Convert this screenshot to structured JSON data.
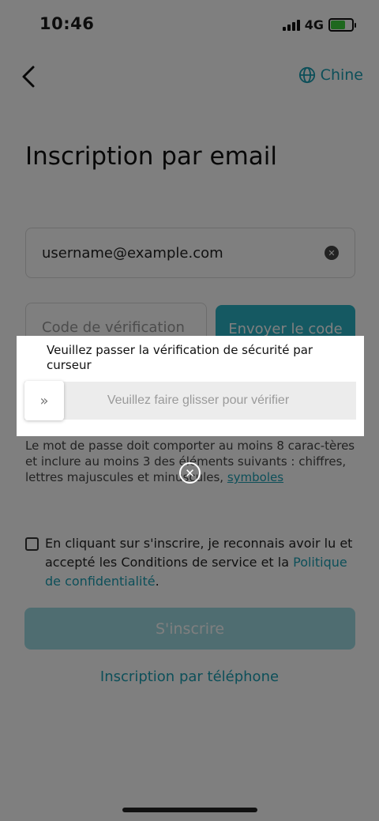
{
  "status": {
    "time": "10:46",
    "network": "4G"
  },
  "header": {
    "language": "Chine",
    "icons": {
      "back": "chevron-left-icon",
      "language": "globe-icon"
    }
  },
  "form": {
    "title": "Inscription par email",
    "email_value": "username@example.com",
    "code_placeholder": "Code de vérification",
    "send_code_label": "Envoyer le code",
    "password_hint_prefix": "Le mot de passe doit comporter au moins 8 carac-tères et inclure au moins 3 des éléments suivants : chiffres, lettres majuscules et minuscules, ",
    "password_hint_link": "symboles",
    "terms_prefix": "En cliquant sur s'inscrire, je reconnais avoir lu et accepté les Conditions de service et la ",
    "terms_link": "Politique de confidentialité",
    "terms_suffix": ".",
    "signup_label": "S'inscrire",
    "phone_signup_label": "Inscription par téléphone"
  },
  "captcha": {
    "title": "Veuillez passer la vérification de sécurité par curseur",
    "slider_text": "Veuillez faire glisser pour vérifier",
    "handle_glyph": "»",
    "close_glyph": "✕"
  },
  "colors": {
    "accent": "#1a9fb3",
    "button": "#2bb3c5",
    "button_disabled": "#9fdbe3"
  }
}
